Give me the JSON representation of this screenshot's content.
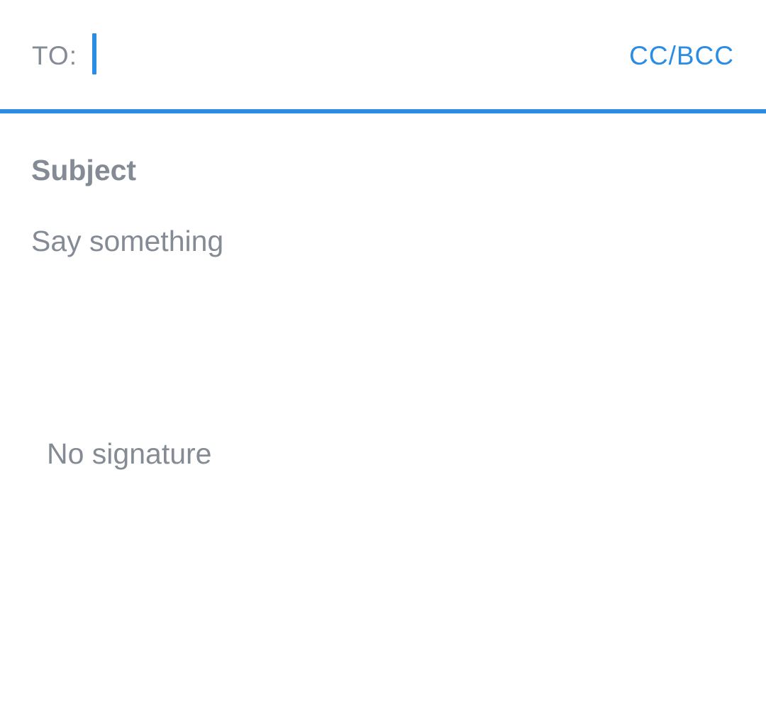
{
  "recipient": {
    "to_label": "TO:",
    "to_value": "",
    "cc_bcc_label": "CC/BCC"
  },
  "message": {
    "subject_placeholder": "Subject",
    "body_placeholder": "Say something",
    "signature_text": "No signature"
  },
  "colors": {
    "accent": "#2b8ce6",
    "text_muted": "#858b95",
    "background": "#ffffff"
  }
}
